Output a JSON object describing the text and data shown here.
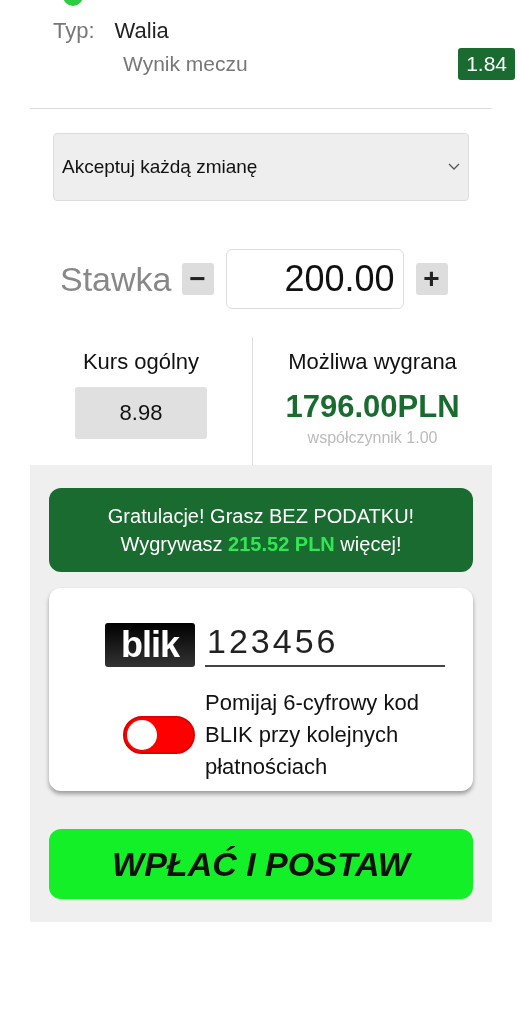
{
  "selection": {
    "type_label": "Typ:",
    "type_value": "Walia",
    "market": "Wynik meczu",
    "odds": "1.84"
  },
  "odds_change": {
    "value": "Akceptuj każdą zmianę"
  },
  "stake": {
    "label": "Stawka",
    "minus": "−",
    "value": "200.00",
    "plus": "+"
  },
  "summary": {
    "total_odds_label": "Kurs ogólny",
    "total_odds": "8.98",
    "win_label": "Możliwa wygrana",
    "win_amount": "1796.00PLN",
    "coefficient": "współczynnik 1.00"
  },
  "tax_banner": {
    "line1": "Gratulacje! Grasz BEZ PODATKU!",
    "line2": "Wygrywasz **215.52 PLN** więcej!"
  },
  "blik": {
    "logo": "blik",
    "code": "123456",
    "remember_label": "Pomijaj 6-cyfrowy kod BLIK przy kolejnych płatnościach",
    "remember_on": false
  },
  "submit": {
    "label": "WPŁAĆ I POSTAW"
  }
}
